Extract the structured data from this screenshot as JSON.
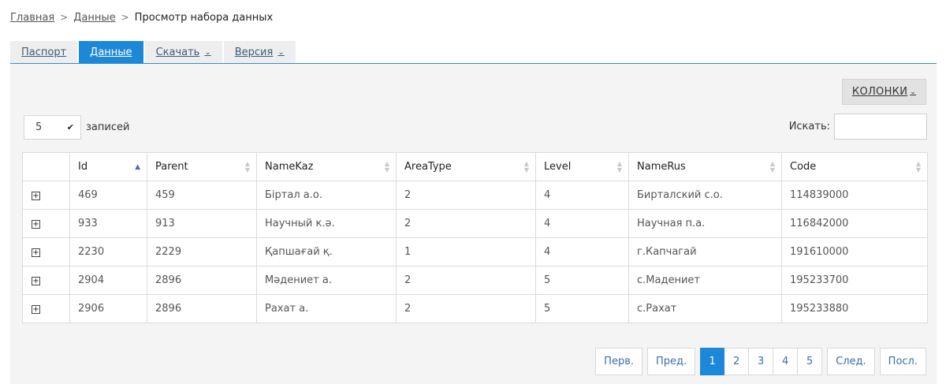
{
  "breadcrumb": {
    "home": "Главная",
    "data": "Данные",
    "current": "Просмотр набора данных"
  },
  "tabs": [
    {
      "label": "Паспорт",
      "active": false
    },
    {
      "label": "Данные",
      "active": true
    },
    {
      "label": "Скачать",
      "active": false,
      "dropdown": true
    },
    {
      "label": "Версия",
      "active": false,
      "dropdown": true
    }
  ],
  "columns_button": {
    "label": "КОЛОНКИ"
  },
  "page_length": {
    "value": "5",
    "label": "записей"
  },
  "search": {
    "label": "Искать:",
    "value": ""
  },
  "table": {
    "headers": [
      "Id",
      "Parent",
      "NameKaz",
      "AreaType",
      "Level",
      "NameRus",
      "Code"
    ],
    "sorted_column": "Id",
    "sort_direction": "asc",
    "rows": [
      [
        "469",
        "459",
        "Біртал а.о.",
        "2",
        "4",
        "Бирталский с.о.",
        "114839000"
      ],
      [
        "933",
        "913",
        "Научный к.ә.",
        "2",
        "4",
        "Научная п.а.",
        "116842000"
      ],
      [
        "2230",
        "2229",
        "Қапшағай қ.",
        "1",
        "4",
        "г.Капчагай",
        "191610000"
      ],
      [
        "2904",
        "2896",
        "Мәдениет а.",
        "2",
        "5",
        "с.Мадениет",
        "195233700"
      ],
      [
        "2906",
        "2896",
        "Рахат а.",
        "2",
        "5",
        "с.Рахат",
        "195233880"
      ]
    ]
  },
  "pagination": {
    "first": "Перв.",
    "prev": "Пред.",
    "pages": [
      "1",
      "2",
      "3",
      "4",
      "5"
    ],
    "current": "1",
    "next": "След.",
    "last": "Посл."
  },
  "colors": {
    "accent": "#1e88d8",
    "panel_bg": "#f4f4f4",
    "tab_bg": "#eeeeee"
  }
}
